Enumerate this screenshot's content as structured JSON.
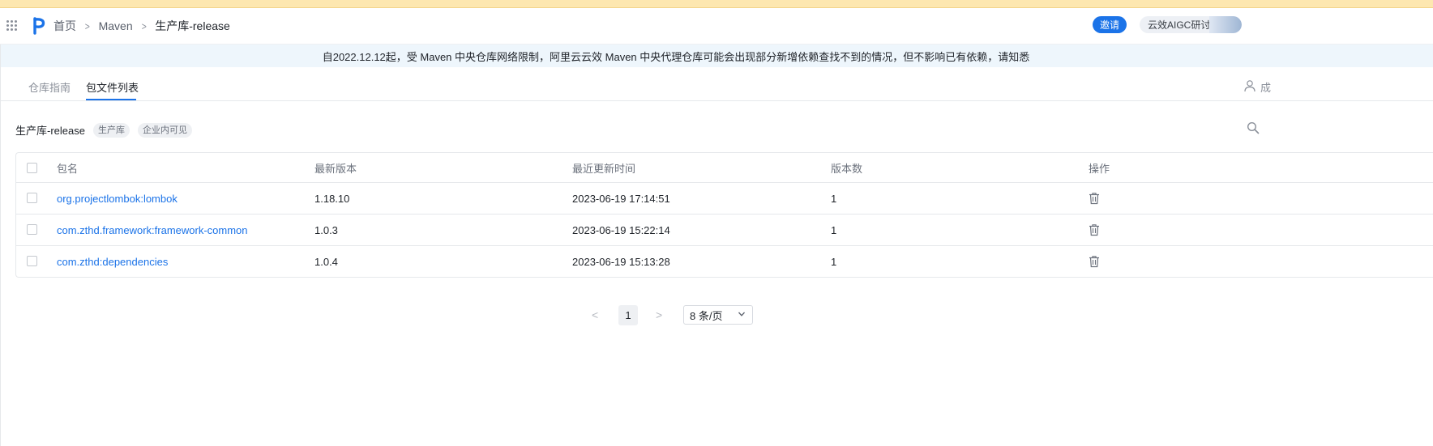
{
  "top_strip": {
    "text": ""
  },
  "header": {
    "breadcrumb": [
      "首页",
      "Maven",
      "生产库-release"
    ],
    "invite_label": "邀请",
    "org_label": "云效AIGC研讨会"
  },
  "notice": {
    "text": "自2022.12.12起，受 Maven 中央仓库网络限制，阿里云云效 Maven 中央代理仓库可能会出现部分新增依赖查找不到的情况，但不影响已有依赖，请知悉"
  },
  "tabs": [
    {
      "label": "仓库指南",
      "active": false
    },
    {
      "label": "包文件列表",
      "active": true
    }
  ],
  "member_label": "成",
  "repo": {
    "name": "生产库-release",
    "tags": [
      "生产库",
      "企业内可见"
    ]
  },
  "table": {
    "columns": [
      "包名",
      "最新版本",
      "最近更新时间",
      "版本数",
      "操作"
    ],
    "rows": [
      {
        "name": "org.projectlombok:lombok",
        "version": "1.18.10",
        "updated": "2023-06-19 17:14:51",
        "count": "1"
      },
      {
        "name": "com.zthd.framework:framework-common",
        "version": "1.0.3",
        "updated": "2023-06-19 15:22:14",
        "count": "1"
      },
      {
        "name": "com.zthd:dependencies",
        "version": "1.0.4",
        "updated": "2023-06-19 15:13:28",
        "count": "1"
      }
    ]
  },
  "pagination": {
    "current_page": "1",
    "page_size": "8 条/页"
  },
  "colors": {
    "accent": "#1b73e8",
    "notice_bg": "#eef6fc",
    "warning_strip": "#fde7b0"
  }
}
